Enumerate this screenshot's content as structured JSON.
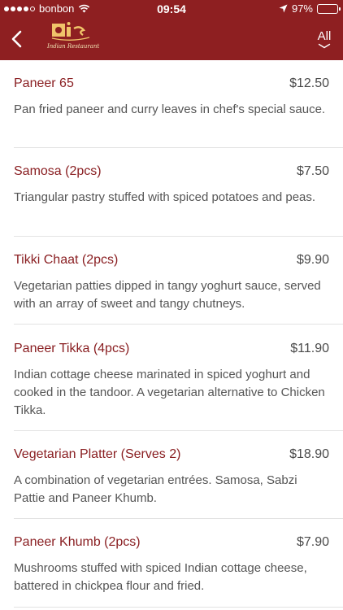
{
  "status_bar": {
    "carrier": "bonbon",
    "time": "09:54",
    "battery": "97%",
    "battery_level": 0.97,
    "signal_bars_filled": 4,
    "signal_bars_total": 5
  },
  "header": {
    "filter_label": "All",
    "logo_text": "Indian Restaurant",
    "background_color": "#8e1f21"
  },
  "menu": {
    "items": [
      {
        "name": "Paneer 65",
        "price": "$12.50",
        "description": "Pan fried paneer and curry leaves in chef's special sauce."
      },
      {
        "name": "Samosa (2pcs)",
        "price": "$7.50",
        "description": "Triangular pastry stuffed with spiced potatoes and peas."
      },
      {
        "name": "Tikki Chaat (2pcs)",
        "price": "$9.90",
        "description": "Vegetarian patties dipped in tangy yoghurt sauce, served with an array of sweet and tangy chutneys."
      },
      {
        "name": "Paneer Tikka (4pcs)",
        "price": "$11.90",
        "description": "Indian cottage cheese marinated in spiced yoghurt and cooked in the tandoor. A vegetarian alternative to Chicken Tikka."
      },
      {
        "name": "Vegetarian Platter (Serves 2)",
        "price": "$18.90",
        "description": "A combination of vegetarian entrées. Samosa, Sabzi Pattie and Paneer Khumb."
      },
      {
        "name": "Paneer Khumb (2pcs)",
        "price": "$7.90",
        "description": "Mushrooms stuffed with spiced Indian cottage cheese, battered in chickpea flour and fried."
      }
    ]
  }
}
